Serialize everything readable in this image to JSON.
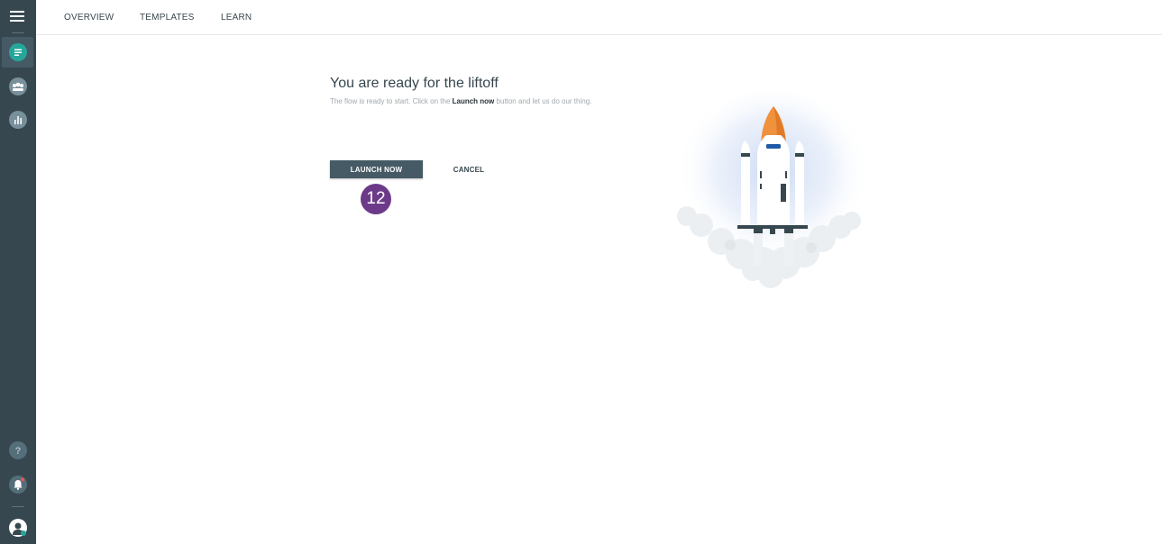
{
  "nav": {
    "tabs": [
      {
        "label": "OVERVIEW"
      },
      {
        "label": "TEMPLATES"
      },
      {
        "label": "LEARN"
      }
    ]
  },
  "sidebar": {
    "items": [
      {
        "icon": "menu-icon"
      },
      {
        "icon": "flows-icon",
        "active": true
      },
      {
        "icon": "audience-icon"
      },
      {
        "icon": "analytics-icon"
      },
      {
        "icon": "help-icon",
        "label": "?"
      },
      {
        "icon": "notifications-icon"
      },
      {
        "icon": "user-avatar-icon"
      }
    ]
  },
  "main": {
    "headline": "You are ready for the liftoff",
    "subtext_before": "The flow is ready to start. Click on the ",
    "subtext_bold": "Launch now",
    "subtext_after": " button and let us do our thing.",
    "launch_label": "LAUNCH NOW",
    "cancel_label": "CANCEL",
    "step_badge": "12",
    "illustration": "rocket-launch-illustration"
  },
  "colors": {
    "sidebar": "#37474f",
    "accent_green": "#26a69a",
    "primary_button": "#455a64",
    "badge": "#6d3a8a",
    "rocket_orange": "#f0913e"
  }
}
